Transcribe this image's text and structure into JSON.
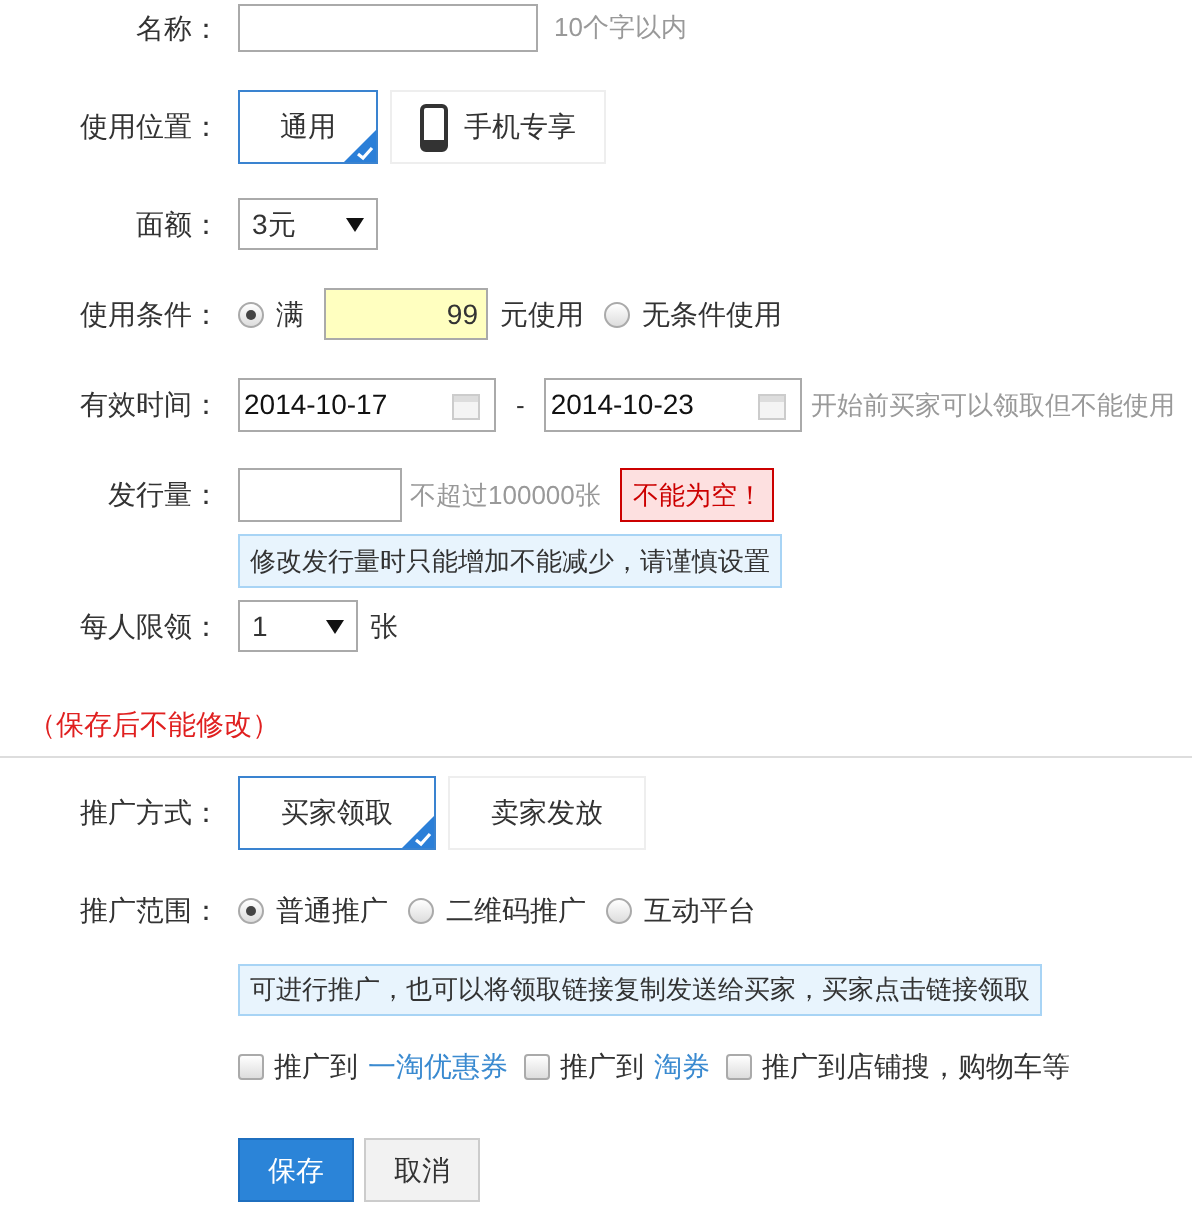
{
  "name": {
    "label": "名称：",
    "hint": "10个字以内"
  },
  "usage_location": {
    "label": "使用位置：",
    "options": [
      {
        "label": "通用",
        "kind": "plain",
        "selected": true
      },
      {
        "label": "手机专享",
        "kind": "phone",
        "selected": false
      }
    ]
  },
  "amount": {
    "label": "面额：",
    "value": "3元"
  },
  "condition": {
    "label": "使用条件：",
    "options": [
      {
        "kind": "threshold",
        "selected": true,
        "prefix": "满",
        "value": "99",
        "suffix": "元使用"
      },
      {
        "kind": "plain",
        "selected": false,
        "label": "无条件使用"
      }
    ]
  },
  "validity": {
    "label": "有效时间：",
    "start": "2014-10-17",
    "separator": "-",
    "end": "2014-10-23",
    "hint": "开始前买家可以领取但不能使用"
  },
  "issue_quantity": {
    "label": "发行量：",
    "hint": "不超过100000张",
    "error": "不能为空！",
    "note": "修改发行量时只能增加不能减少，请谨慎设置"
  },
  "per_person_limit": {
    "label": "每人限领：",
    "value": "1",
    "unit": "张"
  },
  "warning": "（保存后不能修改）",
  "promotion_method": {
    "label": "推广方式：",
    "options": [
      {
        "label": "买家领取",
        "selected": true
      },
      {
        "label": "卖家发放",
        "selected": false
      }
    ]
  },
  "promotion_scope": {
    "label": "推广范围：",
    "options": [
      {
        "label": "普通推广",
        "selected": true
      },
      {
        "label": "二维码推广",
        "selected": false
      },
      {
        "label": "互动平台",
        "selected": false
      }
    ],
    "info": "可进行推广，也可以将领取链接复制发送给买家，买家点击链接领取"
  },
  "channels": [
    {
      "text": "推广到",
      "link": "一淘优惠券",
      "checked": false
    },
    {
      "text": "推广到",
      "link": "淘券",
      "checked": false
    },
    {
      "text": "推广到店铺搜，购物车等",
      "checked": false
    }
  ],
  "buttons": [
    {
      "label": "保存",
      "kind": "primary"
    },
    {
      "label": "取消",
      "kind": "secondary"
    }
  ]
}
